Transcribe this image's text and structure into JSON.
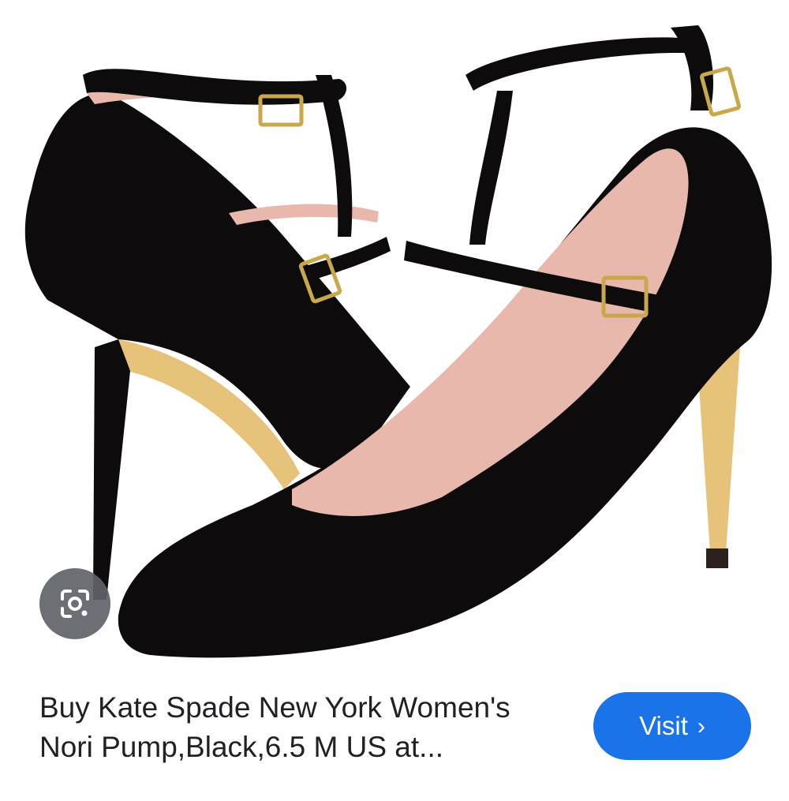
{
  "result": {
    "title_line1": "Buy Kate Spade New York Women's",
    "title_line2": "Nori Pump,Black,6.5 M US at...",
    "visit_label": "Visit",
    "visit_chevron": "›",
    "cutoff_text": "",
    "cutoff_bold": ""
  },
  "icons": {
    "lens": "google-lens-icon",
    "chevron": "chevron-right-icon"
  },
  "colors": {
    "accent": "#1a73e8",
    "shoe": "#0d0b0c",
    "lining": "#e8b8ad",
    "sole": "#e6c27a",
    "buckle": "#c9a84a"
  }
}
